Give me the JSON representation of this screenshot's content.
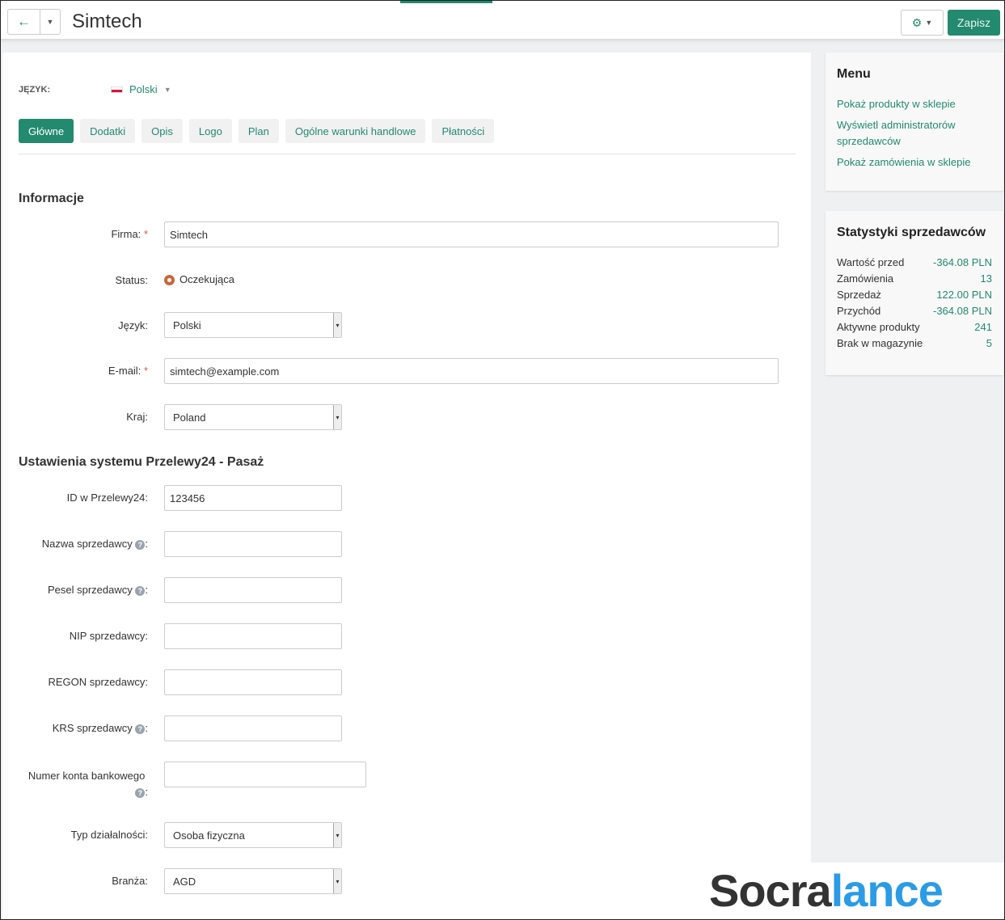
{
  "header": {
    "title": "Simtech",
    "save_label": "Zapisz"
  },
  "language": {
    "label": "JĘZYK:",
    "value": "Polski"
  },
  "tabs": [
    "Główne",
    "Dodatki",
    "Opis",
    "Logo",
    "Plan",
    "Ogólne warunki handlowe",
    "Płatności"
  ],
  "info": {
    "heading": "Informacje",
    "firma_label": "Firma:",
    "firma_value": "Simtech",
    "status_label": "Status:",
    "status_value": "Oczekująca",
    "jezyk_label": "Język:",
    "jezyk_value": "Polski",
    "email_label": "E-mail:",
    "email_value": "simtech@example.com",
    "kraj_label": "Kraj:",
    "kraj_value": "Poland"
  },
  "p24": {
    "heading": "Ustawienia systemu Przelewy24 - Pasaż",
    "id_label": "ID w Przelewy24:",
    "id_value": "123456",
    "nazwa_label": "Nazwa sprzedawcy",
    "pesel_label": "Pesel sprzedawcy",
    "nip_label": "NIP sprzedawcy:",
    "regon_label": "REGON sprzedawcy:",
    "krs_label": "KRS sprzedawcy",
    "konto_label": "Numer konta bankowego",
    "typ_label": "Typ działalności:",
    "typ_value": "Osoba fizyczna",
    "branza_label": "Branża:",
    "branza_value": "AGD"
  },
  "menu": {
    "title": "Menu",
    "links": [
      "Pokaż produkty w sklepie",
      "Wyświetl administratorów sprzedawców",
      "Pokaż zamówienia w sklepie"
    ]
  },
  "stats": {
    "title": "Statystyki sprzedawców",
    "rows": [
      {
        "label": "Wartość przed",
        "value": "-364.08 PLN"
      },
      {
        "label": "Zamówienia",
        "value": "13"
      },
      {
        "label": "Sprzedaż",
        "value": "122.00 PLN"
      },
      {
        "label": "Przychód",
        "value": "-364.08 PLN"
      },
      {
        "label": "Aktywne produkty",
        "value": "241"
      },
      {
        "label": "Brak w magazynie",
        "value": "5"
      }
    ]
  },
  "watermark": {
    "part1": "Socra",
    "part2": "lance"
  }
}
